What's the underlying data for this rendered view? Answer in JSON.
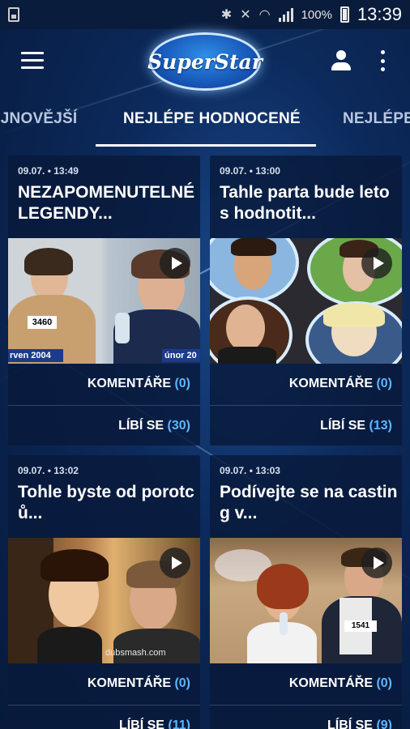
{
  "status_bar": {
    "battery_percent": "100%",
    "time": "13:39"
  },
  "app": {
    "logo_text": "SuperStar"
  },
  "tabs": [
    {
      "label": "NEJNOVĚJŠÍ",
      "active": false
    },
    {
      "label": "NEJLÉPE HODNOCENÉ",
      "active": true
    },
    {
      "label": "NEJLÉPE",
      "active": false
    }
  ],
  "cards": [
    {
      "date": "09.07. • 13:49",
      "title": "NEZAPOMENUTELNÉ LEGENDY...",
      "thumb_captions": [
        "3460",
        "rven 2004",
        "únor 20"
      ],
      "comments_label": "KOMENTÁŘE",
      "comments_count": "(0)",
      "likes_label": "LÍBÍ SE",
      "likes_count": "(30)"
    },
    {
      "date": "09.07. • 13:00",
      "title": "Tahle parta bude letos hodnotit...",
      "thumb_captions": [],
      "comments_label": "KOMENTÁŘE",
      "comments_count": "(0)",
      "likes_label": "LÍBÍ SE",
      "likes_count": "(13)"
    },
    {
      "date": "09.07. • 13:02",
      "title": "Tohle byste od porotců...",
      "thumb_captions": [
        "dubsmash.com"
      ],
      "comments_label": "KOMENTÁŘE",
      "comments_count": "(0)",
      "likes_label": "LÍBÍ SE",
      "likes_count": "(11)"
    },
    {
      "date": "09.07. • 13:03",
      "title": "Podívejte se na casting v...",
      "thumb_captions": [
        "1541"
      ],
      "comments_label": "KOMENTÁŘE",
      "comments_count": "(0)",
      "likes_label": "LÍBÍ SE",
      "likes_count": "(9)"
    }
  ]
}
